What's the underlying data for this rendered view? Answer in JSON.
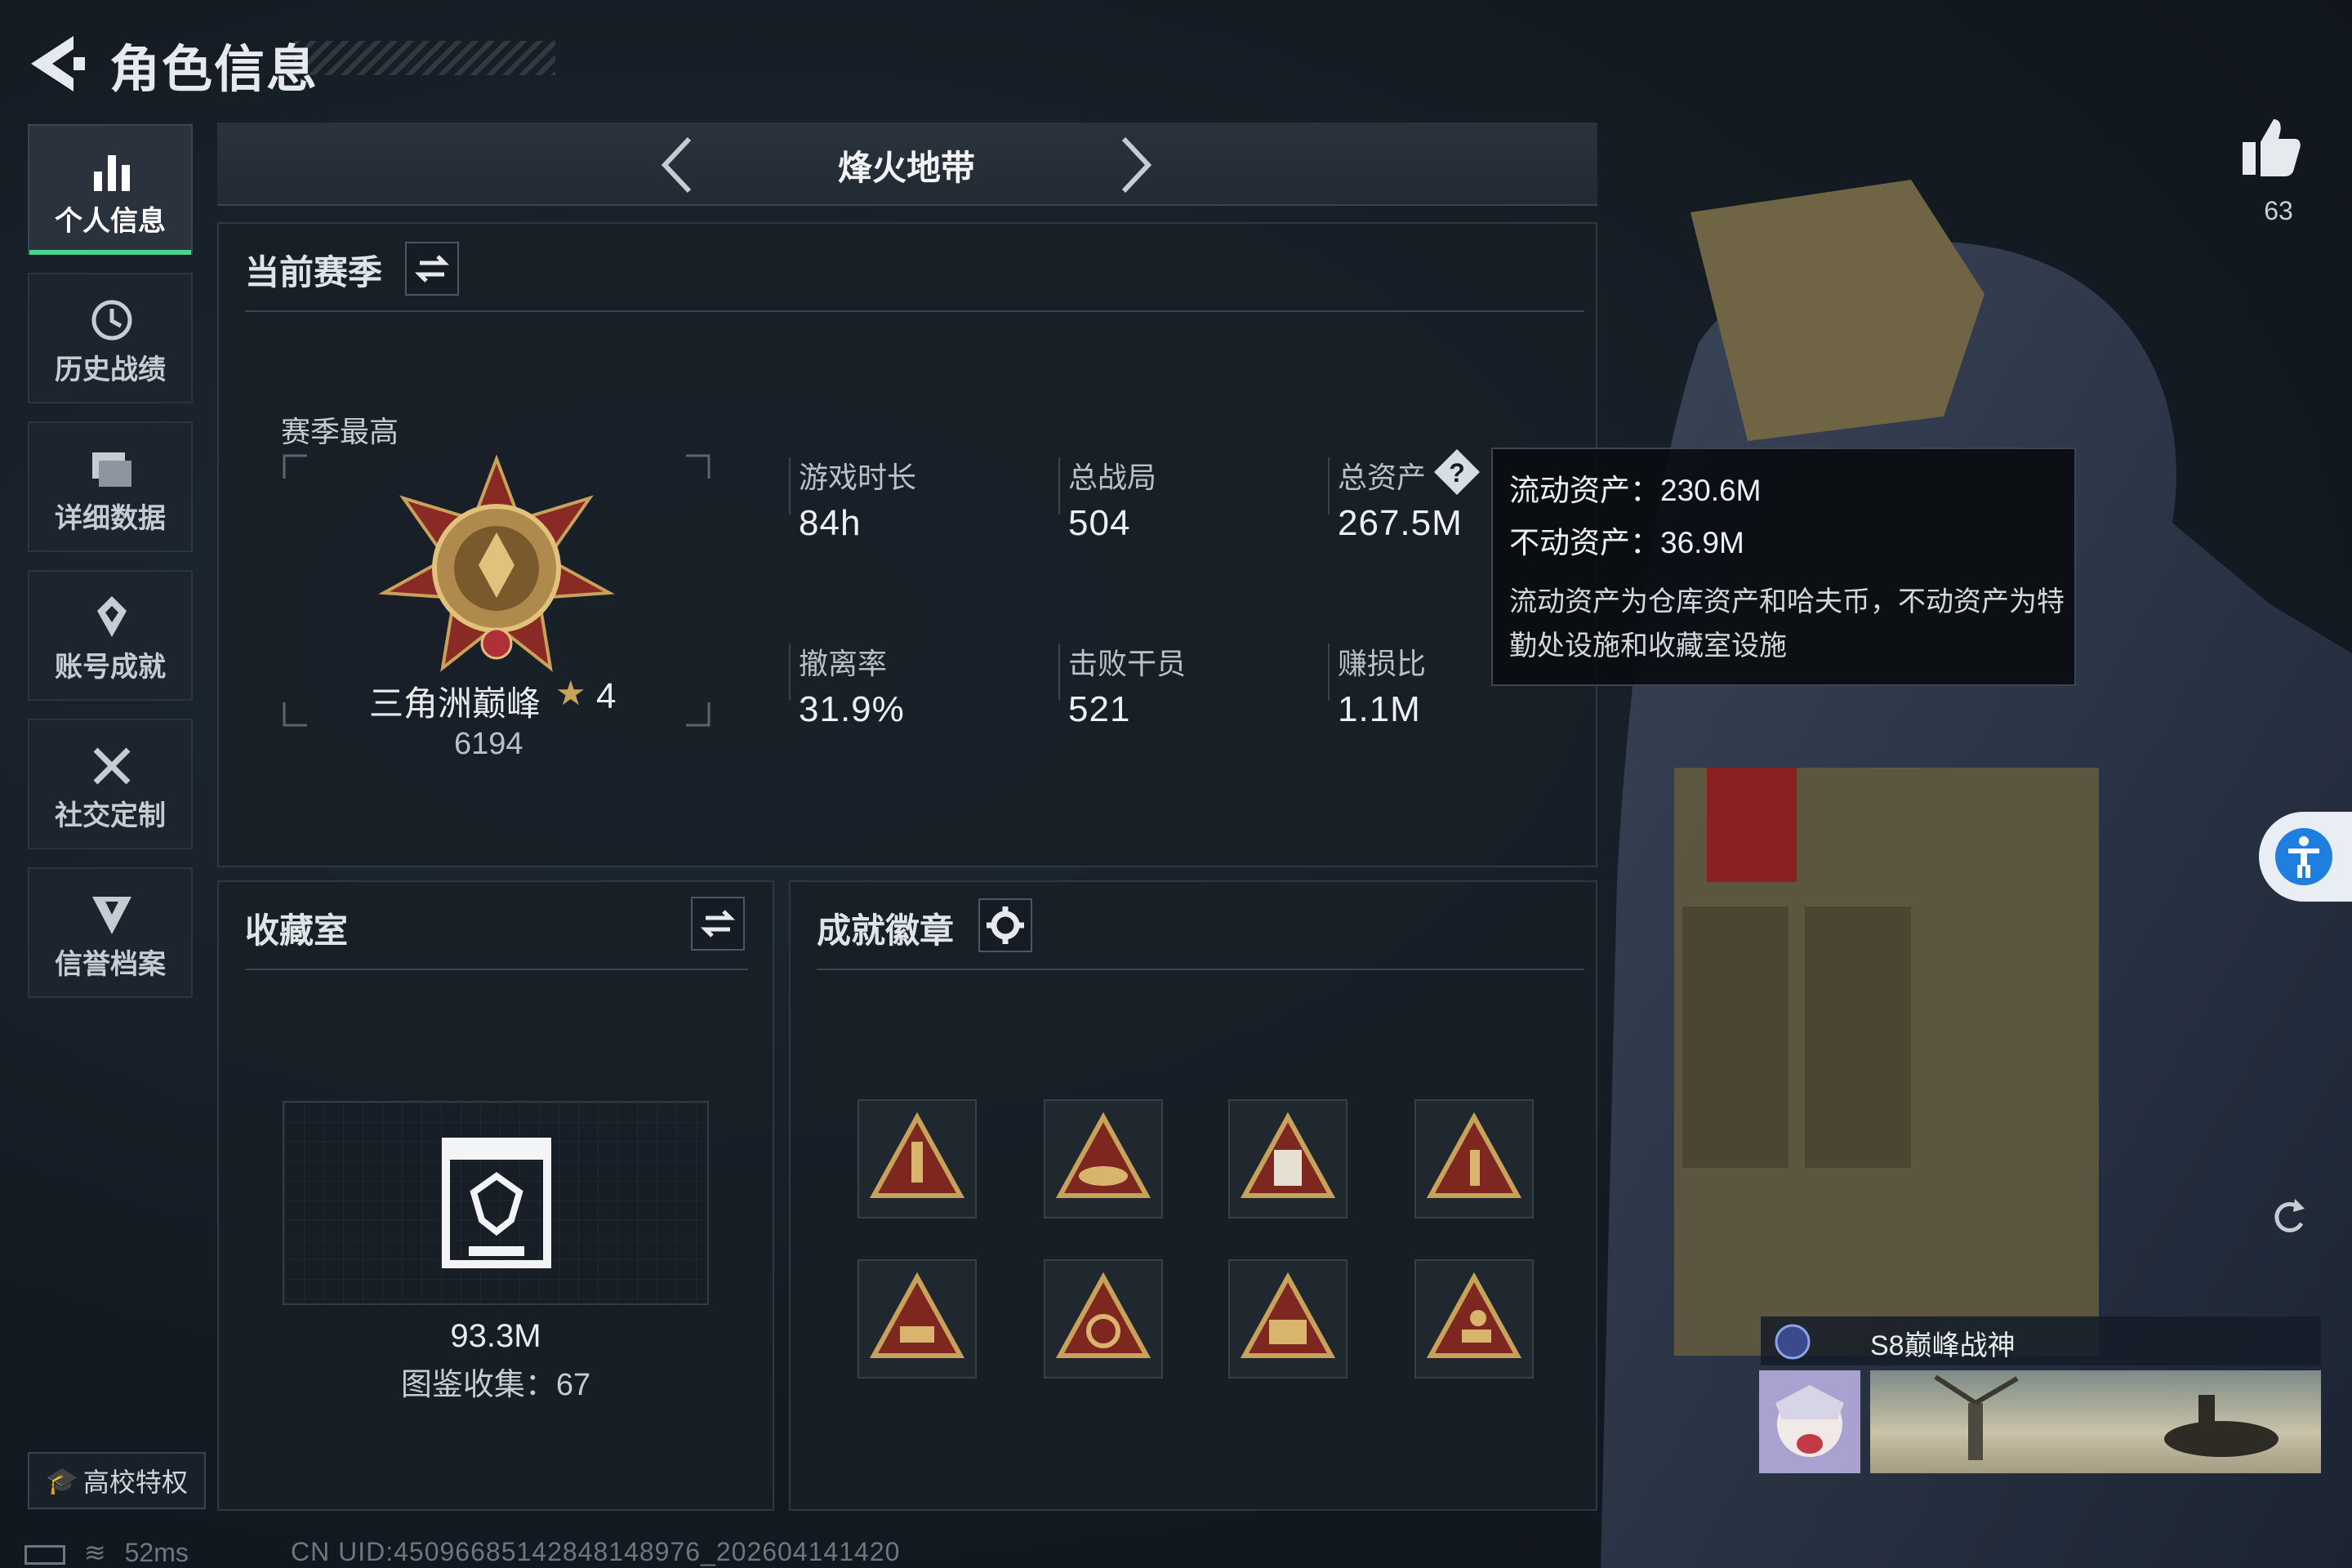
{
  "header": {
    "title": "角色信息"
  },
  "sidebar": {
    "items": [
      {
        "label": "个人信息",
        "icon": "bar-chart-icon",
        "active": true
      },
      {
        "label": "历史战绩",
        "icon": "history-clock-icon"
      },
      {
        "label": "详细数据",
        "icon": "folder-icon"
      },
      {
        "label": "账号成就",
        "icon": "achievement-icon"
      },
      {
        "label": "社交定制",
        "icon": "tools-icon"
      },
      {
        "label": "信誉档案",
        "icon": "shield-icon"
      }
    ],
    "campus_label": "高校特权"
  },
  "mode": {
    "name": "烽火地带"
  },
  "season": {
    "title": "当前赛季",
    "best_label": "赛季最高",
    "rank_name": "三角洲巅峰",
    "rank_stars": "4",
    "rank_score": "6194",
    "stats": [
      {
        "label": "游戏时长",
        "value": "84h"
      },
      {
        "label": "总战局",
        "value": "504"
      },
      {
        "label": "总资产",
        "value": "267.5M"
      },
      {
        "label": "撤离率",
        "value": "31.9%"
      },
      {
        "label": "击败干员",
        "value": "521"
      },
      {
        "label": "赚损比",
        "value": "1.1M"
      }
    ]
  },
  "tooltip": {
    "liquid": "流动资产：230.6M",
    "fixed": "不动资产：36.9M",
    "desc": "流动资产为仓库资产和哈夫币，不动资产为特勤处设施和收藏室设施"
  },
  "collection": {
    "title": "收藏室",
    "value": "93.3M",
    "collect_text": "图鉴收集：67"
  },
  "achievements": {
    "title": "成就徽章",
    "badges": [
      "rocket-badge-icon",
      "crown-badge-icon",
      "s8-badge-icon",
      "number-one-badge-icon",
      "pyramid-badge-icon",
      "emblem-badge-icon",
      "squad-badge-icon",
      "runner-badge-icon"
    ]
  },
  "profile": {
    "likes": "63",
    "player_title": "S8巅峰战神"
  },
  "status": {
    "ping": "52ms",
    "uid": "CN UID:450966851428481489​76_202604141420"
  },
  "colors": {
    "accent": "#4dd28c",
    "gold": "#c9a25a",
    "badge_red": "#8e2a24",
    "assist": "#1f7fe0"
  }
}
